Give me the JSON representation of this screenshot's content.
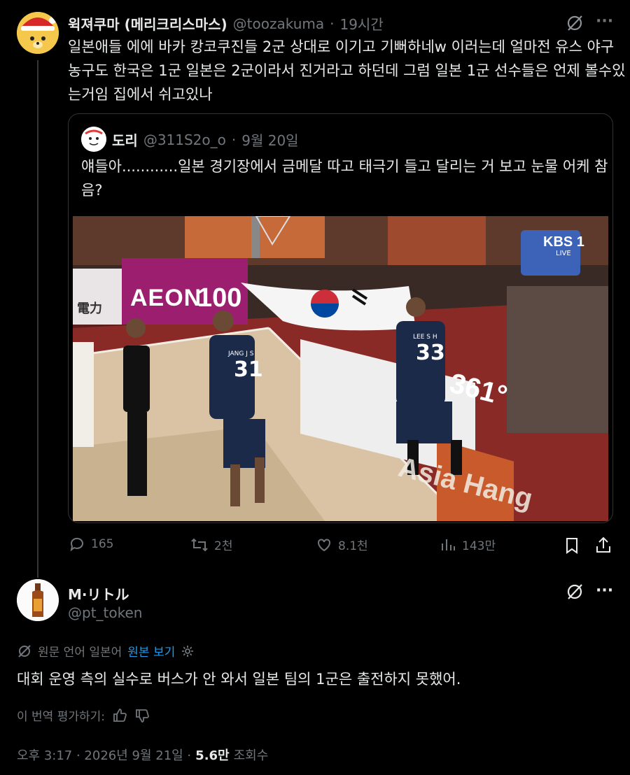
{
  "tweet": {
    "display_name": "윅져쿠마 (메리크리스마스)",
    "handle": "@toozakuma",
    "dot": "·",
    "time": "19시간",
    "text_lines": [
      "일본애들 에에 바카 캉코쿠진들 2군 상대로 이기고 기뻐하네w 이러는데 얼마전 유스 야구",
      "농구도 한국은 1군 일본은 2군이라서 진거라고 하던데 그럼 일본 1군 선수들은 언제 볼수있",
      "는거임 집에서 쉬고있나"
    ],
    "more": "···"
  },
  "quote": {
    "display_name": "도리",
    "handle": "@311S2o_o",
    "dot": "·",
    "date": "9월 20일",
    "text_lines": [
      "얘들아............일본 경기장에서 금메달 따고 태극기 들고 달리는 거 보고 눈물 어케 참",
      "음?"
    ],
    "image": {
      "banner_left": "AEON",
      "banner_num": "100",
      "kanji": "電力",
      "broadcast": "KBS 1",
      "broadcast_sub": "LIVE",
      "player1_name": "JANG J S",
      "player1_num": "31",
      "player2_name": "LEE S H",
      "player2_num": "33",
      "ad_text": "361°"
    }
  },
  "actions": {
    "replies": "165",
    "reposts": "2천",
    "likes": "8.1천",
    "views": "143만"
  },
  "reply": {
    "display_name": "M·リトル",
    "handle": "@pt_token",
    "more": "···",
    "translate_note": "원문 언어 일본어",
    "show_original": "원본 보기",
    "text": "대회 운영 측의 실수로 버스가 안 와서 일본 팀의 1군은 출전하지 못했어.",
    "rate_label": "이 번역 평가하기:",
    "meta_time": "오후 3:17 · 2026년 9월 21일 ·",
    "meta_views_num": "5.6만",
    "meta_views_label": "조회수"
  }
}
